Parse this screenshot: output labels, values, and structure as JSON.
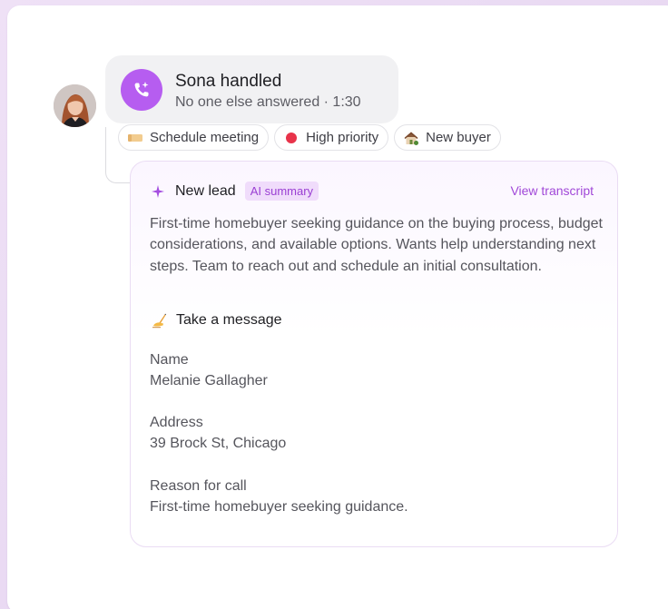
{
  "call": {
    "title": "Sona handled",
    "subtitle": "No one else answered · 1:30",
    "icon": "sparkle-phone-icon",
    "accent": "#b65df0"
  },
  "tags": [
    {
      "label": "Schedule meeting",
      "icon": "ticket-icon"
    },
    {
      "label": "High priority",
      "icon": "red-dot-icon",
      "color": "#e8334a"
    },
    {
      "label": "New buyer",
      "icon": "house-icon"
    }
  ],
  "lead": {
    "title": "New lead",
    "badge": "AI summary",
    "link": "View transcript",
    "summary": "First-time homebuyer seeking guidance on the buying process, budget considerations, and available options. Wants help understanding next steps. Team to reach out and schedule an initial consultation."
  },
  "message": {
    "title": "Take a message",
    "fields": [
      {
        "label": "Name",
        "value": "Melanie Gallagher"
      },
      {
        "label": "Address",
        "value": "39 Brock St, Chicago"
      },
      {
        "label": "Reason for call",
        "value": "First-time homebuyer seeking guidance."
      }
    ]
  }
}
